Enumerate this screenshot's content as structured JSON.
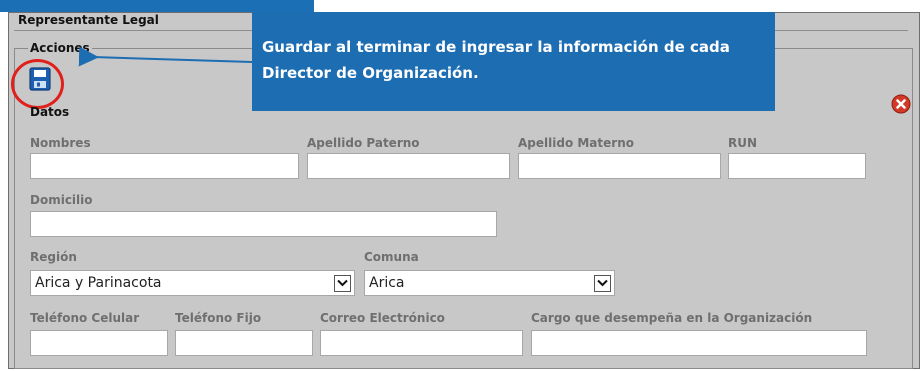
{
  "panel": {
    "title": "Representante Legal",
    "section_acciones": "Acciones",
    "section_datos": "Datos"
  },
  "callout": {
    "line1": "Guardar al terminar de ingresar la información de cada",
    "line2": "Director de Organización."
  },
  "icons": {
    "save": "floppy-disk-icon",
    "close": "close-circle-icon",
    "dropdown": "chevron-down-icon"
  },
  "form": {
    "nombres": {
      "label": "Nombres",
      "value": ""
    },
    "apellido_paterno": {
      "label": "Apellido Paterno",
      "value": ""
    },
    "apellido_materno": {
      "label": "Apellido Materno",
      "value": ""
    },
    "run": {
      "label": "RUN",
      "value": ""
    },
    "domicilio": {
      "label": "Domicilio",
      "value": ""
    },
    "region": {
      "label": "Región",
      "selected": "Arica y Parinacota"
    },
    "comuna": {
      "label": "Comuna",
      "selected": "Arica"
    },
    "telefono_celular": {
      "label": "Teléfono Celular",
      "value": ""
    },
    "telefono_fijo": {
      "label": "Teléfono Fijo",
      "value": ""
    },
    "correo": {
      "label": "Correo Electrónico",
      "value": ""
    },
    "cargo": {
      "label": "Cargo que desempeña en la Organización",
      "value": ""
    }
  },
  "colors": {
    "panel_bg": "#c8c8c8",
    "callout_bg": "#1d6db3",
    "highlight_ring": "#e0201b",
    "label_text": "#6f6f6f"
  }
}
